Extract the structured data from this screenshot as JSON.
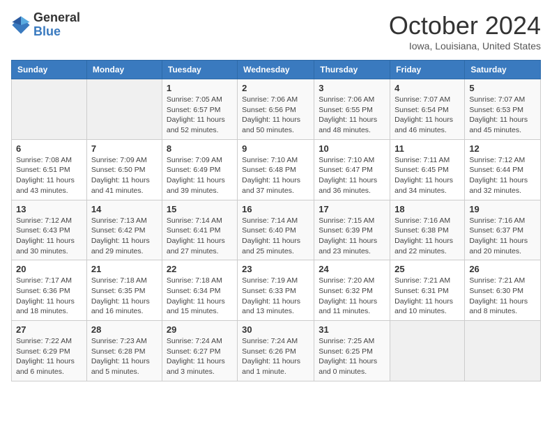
{
  "header": {
    "logo_general": "General",
    "logo_blue": "Blue",
    "month_title": "October 2024",
    "subtitle": "Iowa, Louisiana, United States"
  },
  "days_of_week": [
    "Sunday",
    "Monday",
    "Tuesday",
    "Wednesday",
    "Thursday",
    "Friday",
    "Saturday"
  ],
  "weeks": [
    [
      {
        "num": "",
        "info": ""
      },
      {
        "num": "",
        "info": ""
      },
      {
        "num": "1",
        "info": "Sunrise: 7:05 AM\nSunset: 6:57 PM\nDaylight: 11 hours and 52 minutes."
      },
      {
        "num": "2",
        "info": "Sunrise: 7:06 AM\nSunset: 6:56 PM\nDaylight: 11 hours and 50 minutes."
      },
      {
        "num": "3",
        "info": "Sunrise: 7:06 AM\nSunset: 6:55 PM\nDaylight: 11 hours and 48 minutes."
      },
      {
        "num": "4",
        "info": "Sunrise: 7:07 AM\nSunset: 6:54 PM\nDaylight: 11 hours and 46 minutes."
      },
      {
        "num": "5",
        "info": "Sunrise: 7:07 AM\nSunset: 6:53 PM\nDaylight: 11 hours and 45 minutes."
      }
    ],
    [
      {
        "num": "6",
        "info": "Sunrise: 7:08 AM\nSunset: 6:51 PM\nDaylight: 11 hours and 43 minutes."
      },
      {
        "num": "7",
        "info": "Sunrise: 7:09 AM\nSunset: 6:50 PM\nDaylight: 11 hours and 41 minutes."
      },
      {
        "num": "8",
        "info": "Sunrise: 7:09 AM\nSunset: 6:49 PM\nDaylight: 11 hours and 39 minutes."
      },
      {
        "num": "9",
        "info": "Sunrise: 7:10 AM\nSunset: 6:48 PM\nDaylight: 11 hours and 37 minutes."
      },
      {
        "num": "10",
        "info": "Sunrise: 7:10 AM\nSunset: 6:47 PM\nDaylight: 11 hours and 36 minutes."
      },
      {
        "num": "11",
        "info": "Sunrise: 7:11 AM\nSunset: 6:45 PM\nDaylight: 11 hours and 34 minutes."
      },
      {
        "num": "12",
        "info": "Sunrise: 7:12 AM\nSunset: 6:44 PM\nDaylight: 11 hours and 32 minutes."
      }
    ],
    [
      {
        "num": "13",
        "info": "Sunrise: 7:12 AM\nSunset: 6:43 PM\nDaylight: 11 hours and 30 minutes."
      },
      {
        "num": "14",
        "info": "Sunrise: 7:13 AM\nSunset: 6:42 PM\nDaylight: 11 hours and 29 minutes."
      },
      {
        "num": "15",
        "info": "Sunrise: 7:14 AM\nSunset: 6:41 PM\nDaylight: 11 hours and 27 minutes."
      },
      {
        "num": "16",
        "info": "Sunrise: 7:14 AM\nSunset: 6:40 PM\nDaylight: 11 hours and 25 minutes."
      },
      {
        "num": "17",
        "info": "Sunrise: 7:15 AM\nSunset: 6:39 PM\nDaylight: 11 hours and 23 minutes."
      },
      {
        "num": "18",
        "info": "Sunrise: 7:16 AM\nSunset: 6:38 PM\nDaylight: 11 hours and 22 minutes."
      },
      {
        "num": "19",
        "info": "Sunrise: 7:16 AM\nSunset: 6:37 PM\nDaylight: 11 hours and 20 minutes."
      }
    ],
    [
      {
        "num": "20",
        "info": "Sunrise: 7:17 AM\nSunset: 6:36 PM\nDaylight: 11 hours and 18 minutes."
      },
      {
        "num": "21",
        "info": "Sunrise: 7:18 AM\nSunset: 6:35 PM\nDaylight: 11 hours and 16 minutes."
      },
      {
        "num": "22",
        "info": "Sunrise: 7:18 AM\nSunset: 6:34 PM\nDaylight: 11 hours and 15 minutes."
      },
      {
        "num": "23",
        "info": "Sunrise: 7:19 AM\nSunset: 6:33 PM\nDaylight: 11 hours and 13 minutes."
      },
      {
        "num": "24",
        "info": "Sunrise: 7:20 AM\nSunset: 6:32 PM\nDaylight: 11 hours and 11 minutes."
      },
      {
        "num": "25",
        "info": "Sunrise: 7:21 AM\nSunset: 6:31 PM\nDaylight: 11 hours and 10 minutes."
      },
      {
        "num": "26",
        "info": "Sunrise: 7:21 AM\nSunset: 6:30 PM\nDaylight: 11 hours and 8 minutes."
      }
    ],
    [
      {
        "num": "27",
        "info": "Sunrise: 7:22 AM\nSunset: 6:29 PM\nDaylight: 11 hours and 6 minutes."
      },
      {
        "num": "28",
        "info": "Sunrise: 7:23 AM\nSunset: 6:28 PM\nDaylight: 11 hours and 5 minutes."
      },
      {
        "num": "29",
        "info": "Sunrise: 7:24 AM\nSunset: 6:27 PM\nDaylight: 11 hours and 3 minutes."
      },
      {
        "num": "30",
        "info": "Sunrise: 7:24 AM\nSunset: 6:26 PM\nDaylight: 11 hours and 1 minute."
      },
      {
        "num": "31",
        "info": "Sunrise: 7:25 AM\nSunset: 6:25 PM\nDaylight: 11 hours and 0 minutes."
      },
      {
        "num": "",
        "info": ""
      },
      {
        "num": "",
        "info": ""
      }
    ]
  ]
}
